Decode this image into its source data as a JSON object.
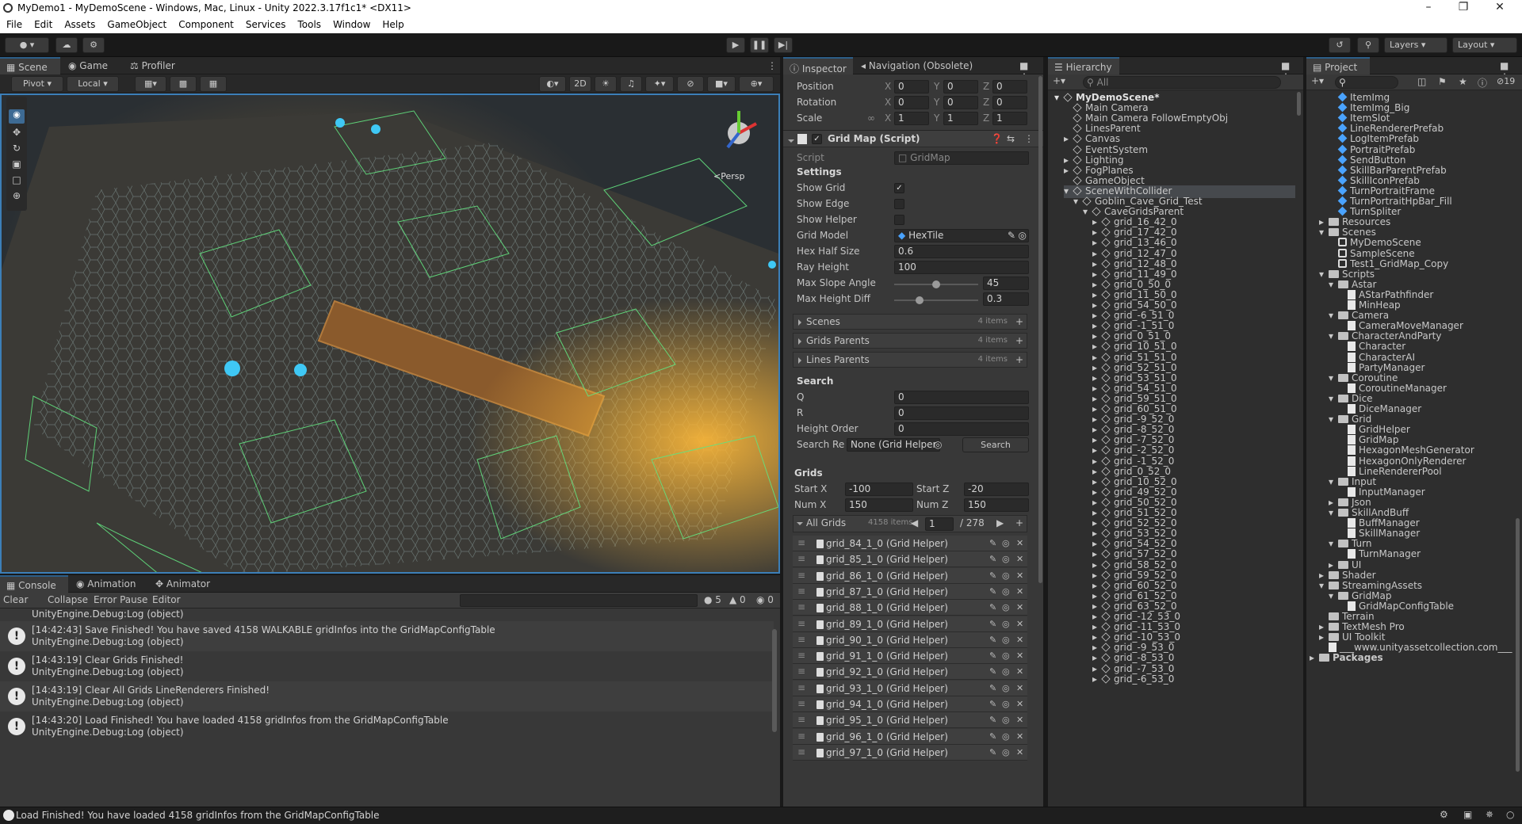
{
  "window": {
    "title": "MyDemo1 - MyDemoScene - Windows, Mac, Linux - Unity 2022.3.17f1c1* <DX11>"
  },
  "menu": [
    "File",
    "Edit",
    "Assets",
    "GameObject",
    "Component",
    "Services",
    "Tools",
    "Window",
    "Help"
  ],
  "toolbar": {
    "layers": "Layers",
    "layout": "Layout"
  },
  "scene_tabs": [
    {
      "label": "Scene",
      "active": true
    },
    {
      "label": "Game"
    },
    {
      "label": "Profiler"
    }
  ],
  "scene_toolbar": {
    "pivot": "Pivot",
    "local": "Local",
    "mode_2d": "2D",
    "persp": "<Persp"
  },
  "inspector": {
    "tabs": [
      "Inspector",
      "Navigation (Obsolete)"
    ],
    "transform": {
      "position": {
        "label": "Position",
        "x": "0",
        "y": "0",
        "z": "0"
      },
      "rotation": {
        "label": "Rotation",
        "x": "0",
        "y": "0",
        "z": "0"
      },
      "scale": {
        "label": "Scale",
        "x": "1",
        "y": "1",
        "z": "1"
      }
    },
    "component": {
      "title": "Grid Map (Script)",
      "script_label": "Script",
      "script_value": "GridMap"
    },
    "settings": {
      "header": "Settings",
      "show_grid": "Show Grid",
      "show_edge": "Show Edge",
      "show_helper": "Show Helper",
      "show_grid_checked": true,
      "show_edge_checked": false,
      "show_helper_checked": false,
      "grid_model_label": "Grid Model",
      "grid_model_value": "HexTile",
      "hex_half_size_label": "Hex Half Size",
      "hex_half_size": "0.6",
      "ray_height_label": "Ray Height",
      "ray_height": "100",
      "max_slope_label": "Max Slope Angle",
      "max_slope": "45",
      "max_slope_fraction": 0.5,
      "max_height_label": "Max Height Diff",
      "max_height": "0.3",
      "max_height_fraction": 0.3
    },
    "lists": [
      {
        "label": "Scenes",
        "count": "4 items"
      },
      {
        "label": "Grids Parents",
        "count": "4 items"
      },
      {
        "label": "Lines Parents",
        "count": "4 items"
      }
    ],
    "search": {
      "header": "Search",
      "q_label": "Q",
      "q": "0",
      "r_label": "R",
      "r": "0",
      "height_label": "Height Order",
      "height": "0",
      "result_label": "Search Re",
      "result_value": "None (Grid Helper",
      "button": "Search"
    },
    "grids": {
      "header": "Grids",
      "start_x_label": "Start X",
      "start_x": "-100",
      "start_z_label": "Start Z",
      "start_z": "-20",
      "num_x_label": "Num X",
      "num_x": "150",
      "num_z_label": "Num Z",
      "num_z": "150",
      "all_label": "All Grids",
      "all_count": "4158 items",
      "page": "1",
      "pages": "/ 278",
      "items": [
        "grid_84_1_0 (Grid Helper)",
        "grid_85_1_0 (Grid Helper)",
        "grid_86_1_0 (Grid Helper)",
        "grid_87_1_0 (Grid Helper)",
        "grid_88_1_0 (Grid Helper)",
        "grid_89_1_0 (Grid Helper)",
        "grid_90_1_0 (Grid Helper)",
        "grid_91_1_0 (Grid Helper)",
        "grid_92_1_0 (Grid Helper)",
        "grid_93_1_0 (Grid Helper)",
        "grid_94_1_0 (Grid Helper)",
        "grid_95_1_0 (Grid Helper)",
        "grid_96_1_0 (Grid Helper)",
        "grid_97_1_0 (Grid Helper)"
      ]
    }
  },
  "hierarchy": {
    "tab": "Hierarchy",
    "search_placeholder": "All",
    "items": [
      {
        "label": "MyDemoScene*",
        "depth": 0,
        "bold": true
      },
      {
        "label": "Main Camera",
        "depth": 1
      },
      {
        "label": "Main Camera FollowEmptyObj",
        "depth": 1
      },
      {
        "label": "LinesParent",
        "depth": 1
      },
      {
        "label": "Canvas",
        "depth": 1,
        "arrow": true
      },
      {
        "label": "EventSystem",
        "depth": 1
      },
      {
        "label": "Lighting",
        "depth": 1,
        "arrow": true
      },
      {
        "label": "FogPlanes",
        "depth": 1,
        "arrow": true
      },
      {
        "label": "GameObject",
        "depth": 1
      },
      {
        "label": "SceneWithCollider",
        "depth": 1,
        "open": true,
        "selected": true
      },
      {
        "label": "Goblin_Cave_Grid_Test",
        "depth": 2,
        "open": true
      },
      {
        "label": "CaveGridsParent",
        "depth": 3,
        "open": true
      },
      {
        "label": "grid_16_42_0",
        "depth": 4,
        "arrow": true
      },
      {
        "label": "grid_17_42_0",
        "depth": 4,
        "arrow": true
      },
      {
        "label": "grid_13_46_0",
        "depth": 4,
        "arrow": true
      },
      {
        "label": "grid_12_47_0",
        "depth": 4,
        "arrow": true
      },
      {
        "label": "grid_12_48_0",
        "depth": 4,
        "arrow": true
      },
      {
        "label": "grid_11_49_0",
        "depth": 4,
        "arrow": true
      },
      {
        "label": "grid_0_50_0",
        "depth": 4,
        "arrow": true
      },
      {
        "label": "grid_11_50_0",
        "depth": 4,
        "arrow": true
      },
      {
        "label": "grid_54_50_0",
        "depth": 4,
        "arrow": true
      },
      {
        "label": "grid_-6_51_0",
        "depth": 4,
        "arrow": true
      },
      {
        "label": "grid_-1_51_0",
        "depth": 4,
        "arrow": true
      },
      {
        "label": "grid_0_51_0",
        "depth": 4,
        "arrow": true
      },
      {
        "label": "grid_10_51_0",
        "depth": 4,
        "arrow": true
      },
      {
        "label": "grid_51_51_0",
        "depth": 4,
        "arrow": true
      },
      {
        "label": "grid_52_51_0",
        "depth": 4,
        "arrow": true
      },
      {
        "label": "grid_53_51_0",
        "depth": 4,
        "arrow": true
      },
      {
        "label": "grid_54_51_0",
        "depth": 4,
        "arrow": true
      },
      {
        "label": "grid_59_51_0",
        "depth": 4,
        "arrow": true
      },
      {
        "label": "grid_60_51_0",
        "depth": 4,
        "arrow": true
      },
      {
        "label": "grid_-9_52_0",
        "depth": 4,
        "arrow": true
      },
      {
        "label": "grid_-8_52_0",
        "depth": 4,
        "arrow": true
      },
      {
        "label": "grid_-7_52_0",
        "depth": 4,
        "arrow": true
      },
      {
        "label": "grid_-2_52_0",
        "depth": 4,
        "arrow": true
      },
      {
        "label": "grid_-1_52_0",
        "depth": 4,
        "arrow": true
      },
      {
        "label": "grid_0_52_0",
        "depth": 4,
        "arrow": true
      },
      {
        "label": "grid_10_52_0",
        "depth": 4,
        "arrow": true
      },
      {
        "label": "grid_49_52_0",
        "depth": 4,
        "arrow": true
      },
      {
        "label": "grid_50_52_0",
        "depth": 4,
        "arrow": true
      },
      {
        "label": "grid_51_52_0",
        "depth": 4,
        "arrow": true
      },
      {
        "label": "grid_52_52_0",
        "depth": 4,
        "arrow": true
      },
      {
        "label": "grid_53_52_0",
        "depth": 4,
        "arrow": true
      },
      {
        "label": "grid_54_52_0",
        "depth": 4,
        "arrow": true
      },
      {
        "label": "grid_57_52_0",
        "depth": 4,
        "arrow": true
      },
      {
        "label": "grid_58_52_0",
        "depth": 4,
        "arrow": true
      },
      {
        "label": "grid_59_52_0",
        "depth": 4,
        "arrow": true
      },
      {
        "label": "grid_60_52_0",
        "depth": 4,
        "arrow": true
      },
      {
        "label": "grid_61_52_0",
        "depth": 4,
        "arrow": true
      },
      {
        "label": "grid_63_52_0",
        "depth": 4,
        "arrow": true
      },
      {
        "label": "grid_-12_53_0",
        "depth": 4,
        "arrow": true
      },
      {
        "label": "grid_-11_53_0",
        "depth": 4,
        "arrow": true
      },
      {
        "label": "grid_-10_53_0",
        "depth": 4,
        "arrow": true
      },
      {
        "label": "grid_-9_53_0",
        "depth": 4,
        "arrow": true
      },
      {
        "label": "grid_-8_53_0",
        "depth": 4,
        "arrow": true
      },
      {
        "label": "grid_-7_53_0",
        "depth": 4,
        "arrow": true
      },
      {
        "label": "grid_-6_53_0",
        "depth": 4,
        "arrow": true
      }
    ]
  },
  "project": {
    "tab": "Project",
    "hidden_count": "19",
    "items": [
      {
        "label": "ItemImg",
        "depth": 2,
        "kind": "prefab"
      },
      {
        "label": "ItemImg_Big",
        "depth": 2,
        "kind": "prefab"
      },
      {
        "label": "ItemSlot",
        "depth": 2,
        "kind": "prefab"
      },
      {
        "label": "LineRendererPrefab",
        "depth": 2,
        "kind": "prefab"
      },
      {
        "label": "LogItemPrefab",
        "depth": 2,
        "kind": "prefab"
      },
      {
        "label": "PortraitPrefab",
        "depth": 2,
        "kind": "prefab"
      },
      {
        "label": "SendButton",
        "depth": 2,
        "kind": "prefab"
      },
      {
        "label": "SkillBarParentPrefab",
        "depth": 2,
        "kind": "prefab"
      },
      {
        "label": "SkillIconPrefab",
        "depth": 2,
        "kind": "prefab"
      },
      {
        "label": "TurnPortraitFrame",
        "depth": 2,
        "kind": "prefab"
      },
      {
        "label": "TurnPortraitHpBar_Fill",
        "depth": 2,
        "kind": "prefab"
      },
      {
        "label": "TurnSpliter",
        "depth": 2,
        "kind": "prefab"
      },
      {
        "label": "Resources",
        "depth": 1,
        "kind": "folder",
        "arrow": "right"
      },
      {
        "label": "Scenes",
        "depth": 1,
        "kind": "folder",
        "arrow": "down"
      },
      {
        "label": "MyDemoScene",
        "depth": 2,
        "kind": "scene"
      },
      {
        "label": "SampleScene",
        "depth": 2,
        "kind": "scene"
      },
      {
        "label": "Test1_GridMap_Copy",
        "depth": 2,
        "kind": "scene"
      },
      {
        "label": "Scripts",
        "depth": 1,
        "kind": "folder",
        "arrow": "down"
      },
      {
        "label": "Astar",
        "depth": 2,
        "kind": "folder",
        "arrow": "down"
      },
      {
        "label": "AStarPathfinder",
        "depth": 3,
        "kind": "script"
      },
      {
        "label": "MinHeap",
        "depth": 3,
        "kind": "script"
      },
      {
        "label": "Camera",
        "depth": 2,
        "kind": "folder",
        "arrow": "down"
      },
      {
        "label": "CameraMoveManager",
        "depth": 3,
        "kind": "script"
      },
      {
        "label": "CharacterAndParty",
        "depth": 2,
        "kind": "folder",
        "arrow": "down"
      },
      {
        "label": "Character",
        "depth": 3,
        "kind": "script"
      },
      {
        "label": "CharacterAI",
        "depth": 3,
        "kind": "script"
      },
      {
        "label": "PartyManager",
        "depth": 3,
        "kind": "script"
      },
      {
        "label": "Coroutine",
        "depth": 2,
        "kind": "folder",
        "arrow": "down"
      },
      {
        "label": "CoroutineManager",
        "depth": 3,
        "kind": "script"
      },
      {
        "label": "Dice",
        "depth": 2,
        "kind": "folder",
        "arrow": "down"
      },
      {
        "label": "DiceManager",
        "depth": 3,
        "kind": "script"
      },
      {
        "label": "Grid",
        "depth": 2,
        "kind": "folder",
        "arrow": "down"
      },
      {
        "label": "GridHelper",
        "depth": 3,
        "kind": "script"
      },
      {
        "label": "GridMap",
        "depth": 3,
        "kind": "script"
      },
      {
        "label": "HexagonMeshGenerator",
        "depth": 3,
        "kind": "script"
      },
      {
        "label": "HexagonOnlyRenderer",
        "depth": 3,
        "kind": "script"
      },
      {
        "label": "LineRendererPool",
        "depth": 3,
        "kind": "script"
      },
      {
        "label": "Input",
        "depth": 2,
        "kind": "folder",
        "arrow": "down"
      },
      {
        "label": "InputManager",
        "depth": 3,
        "kind": "script"
      },
      {
        "label": "Json",
        "depth": 2,
        "kind": "folder",
        "arrow": "right"
      },
      {
        "label": "SkillAndBuff",
        "depth": 2,
        "kind": "folder",
        "arrow": "down"
      },
      {
        "label": "BuffManager",
        "depth": 3,
        "kind": "script"
      },
      {
        "label": "SkillManager",
        "depth": 3,
        "kind": "script"
      },
      {
        "label": "Turn",
        "depth": 2,
        "kind": "folder",
        "arrow": "down"
      },
      {
        "label": "TurnManager",
        "depth": 3,
        "kind": "script"
      },
      {
        "label": "UI",
        "depth": 2,
        "kind": "folder",
        "arrow": "right"
      },
      {
        "label": "Shader",
        "depth": 1,
        "kind": "folder",
        "arrow": "right"
      },
      {
        "label": "StreamingAssets",
        "depth": 1,
        "kind": "folder",
        "arrow": "down"
      },
      {
        "label": "GridMap",
        "depth": 2,
        "kind": "folder",
        "arrow": "down"
      },
      {
        "label": "GridMapConfigTable",
        "depth": 3,
        "kind": "doc"
      },
      {
        "label": "Terrain",
        "depth": 1,
        "kind": "folder"
      },
      {
        "label": "TextMesh Pro",
        "depth": 1,
        "kind": "folder",
        "arrow": "right"
      },
      {
        "label": "UI Toolkit",
        "depth": 1,
        "kind": "folder",
        "arrow": "right"
      },
      {
        "label": "___www.unityassetcollection.com___",
        "depth": 1,
        "kind": "doc"
      },
      {
        "label": "Packages",
        "depth": 0,
        "kind": "folder",
        "arrow": "right",
        "bold": true
      }
    ]
  },
  "console": {
    "tabs": [
      "Console",
      "Animation",
      "Animator"
    ],
    "clear": "Clear",
    "collapse": "Collapse",
    "error_pause": "Error Pause",
    "editor": "Editor",
    "count_log": "5",
    "count_warn": "0",
    "count_err": "0",
    "partial_top": "UnityEngine.Debug:Log (object)",
    "logs": [
      {
        "line1": "[14:42:43] Save Finished! You have saved 4158 WALKABLE gridInfos into the GridMapConfigTable",
        "line2": "UnityEngine.Debug:Log (object)"
      },
      {
        "line1": "[14:43:19] Clear Grids Finished!",
        "line2": "UnityEngine.Debug:Log (object)"
      },
      {
        "line1": "[14:43:19] Clear All Grids LineRenderers Finished!",
        "line2": "UnityEngine.Debug:Log (object)"
      },
      {
        "line1": "[14:43:20] Load Finished! You have loaded 4158 gridInfos from the GridMapConfigTable",
        "line2": "UnityEngine.Debug:Log (object)"
      }
    ]
  },
  "statusbar": {
    "message": "Load Finished! You have loaded 4158 gridInfos from the GridMapConfigTable"
  }
}
